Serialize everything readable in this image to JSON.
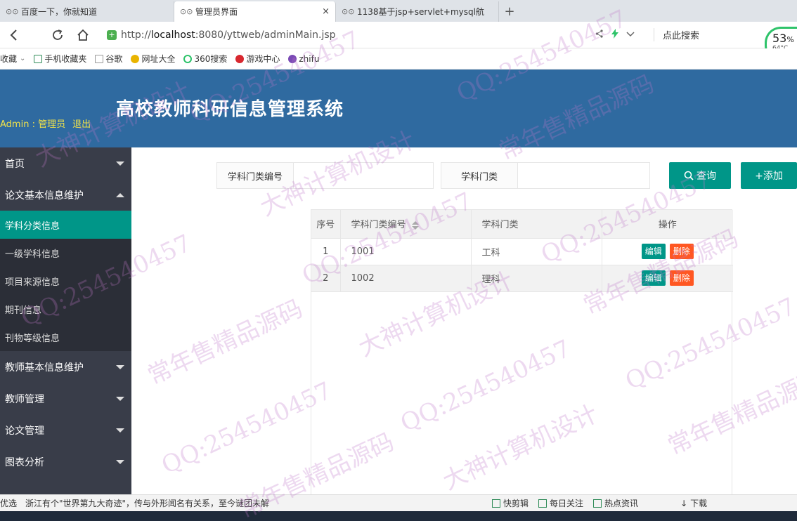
{
  "browser": {
    "tabs": [
      {
        "label": "百度一下，你就知道",
        "active": false
      },
      {
        "label": "管理员界面",
        "active": true
      },
      {
        "label": "1138基于jsp+servlet+mysql航",
        "active": false
      }
    ],
    "close_glyph": "×",
    "newtab_glyph": "+",
    "url_prefix": "http://",
    "url_host": "localhost",
    "url_rest": ":8080/yttweb/adminMain.jsp",
    "search_label": "点此搜索",
    "cpu_percent": "53",
    "cpu_unit": "%",
    "cpu_temp": "64°C",
    "bookmarks": [
      "收藏",
      "手机收藏夹",
      "谷歌",
      "网址大全",
      "360搜索",
      "游戏中心",
      "zhifu"
    ]
  },
  "header": {
    "admin_label": "Admin : 管理员",
    "logout_label": "退出",
    "title": "高校教师科研信息管理系统"
  },
  "sidebar": {
    "groups": [
      {
        "label": "首页",
        "expanded": false
      },
      {
        "label": "论文基本信息维护",
        "expanded": true,
        "items": [
          {
            "label": "学科分类信息",
            "active": true
          },
          {
            "label": "一级学科信息",
            "active": false
          },
          {
            "label": "项目来源信息",
            "active": false
          },
          {
            "label": "期刊信息",
            "active": false
          },
          {
            "label": "刊物等级信息",
            "active": false
          }
        ]
      },
      {
        "label": "教师基本信息维护",
        "expanded": false
      },
      {
        "label": "教师管理",
        "expanded": false
      },
      {
        "label": "论文管理",
        "expanded": false
      },
      {
        "label": "图表分析",
        "expanded": false
      }
    ]
  },
  "search": {
    "field1_label": "学科门类编号",
    "field1_value": "",
    "field2_label": "学科门类",
    "field2_value": "",
    "query_button": "查询",
    "add_button": "+添加"
  },
  "table": {
    "headers": [
      "序号",
      "学科门类编号",
      "学科门类",
      "操作"
    ],
    "rows": [
      {
        "index": "1",
        "code": "1001",
        "name": "工科"
      },
      {
        "index": "2",
        "code": "1002",
        "name": "理科"
      }
    ],
    "edit_label": "编辑",
    "delete_label": "删除"
  },
  "statusbar": {
    "left": "优选",
    "news": "浙江有个\"世界第九大奇迹\"，传与外形闻名有关系，至今谜团未解",
    "items": [
      "快剪辑",
      "每日关注",
      "热点资讯",
      "下载"
    ]
  },
  "watermark": [
    "大神计算机设计",
    "QQ:254540457",
    "常年售精品源码"
  ],
  "colors": {
    "header_bg": "#2f6aa0",
    "sidebar_bg": "#393d49",
    "accent": "#009688",
    "danger": "#ff5722",
    "admin_text": "#f1e24a"
  }
}
